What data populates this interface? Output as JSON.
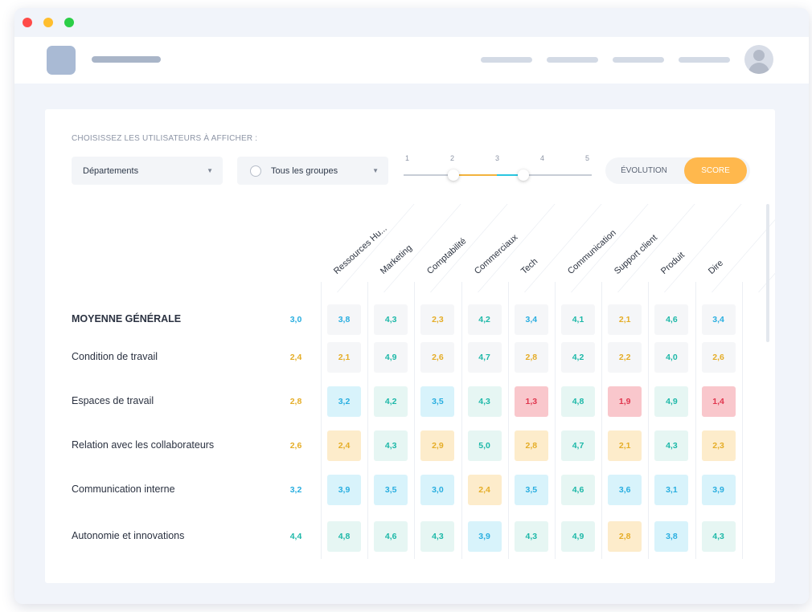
{
  "filters": {
    "title": "CHOISISSEZ LES UTILISATEURS À AFFICHER :",
    "dept_select": "Départements",
    "group_select": "Tous les groupes",
    "slider_labels": [
      "1",
      "2",
      "3",
      "4",
      "5"
    ],
    "view_toggle": {
      "evolution": "ÉVOLUTION",
      "score": "SCORE"
    }
  },
  "colors": {
    "teal": "#1db8a8",
    "blue": "#29aee0",
    "yellow": "#e5ad27",
    "red": "#e0364e",
    "teal_bg": "#e6f6f3",
    "blue_bg": "#d8f3fb",
    "yellow_bg": "#fdeccb",
    "red_bg": "#f9c7cc",
    "neutral_bg": "#f5f6f8",
    "accent": "#ffb84d"
  },
  "table": {
    "columns": [
      "Ressources Hu...",
      "Marketing",
      "Comptabilité",
      "Commerciaux",
      "Tech",
      "Communication",
      "Support client",
      "Produit",
      "Dire"
    ],
    "rows": [
      {
        "label": "MOYENNE GÉNÉRALE",
        "main": true,
        "avg": "3,0",
        "avg_tone": "blue",
        "cells": [
          [
            "3,8",
            "blue",
            "neutral"
          ],
          [
            "4,3",
            "teal",
            "neutral"
          ],
          [
            "2,3",
            "yellow",
            "neutral"
          ],
          [
            "4,2",
            "teal",
            "neutral"
          ],
          [
            "3,4",
            "blue",
            "neutral"
          ],
          [
            "4,1",
            "teal",
            "neutral"
          ],
          [
            "2,1",
            "yellow",
            "neutral"
          ],
          [
            "4,6",
            "teal",
            "neutral"
          ],
          [
            "3,4",
            "blue",
            "neutral"
          ]
        ]
      },
      {
        "label": "Condition de travail",
        "avg": "2,4",
        "avg_tone": "yellow",
        "cells": [
          [
            "2,1",
            "yellow",
            "neutral"
          ],
          [
            "4,9",
            "teal",
            "neutral"
          ],
          [
            "2,6",
            "yellow",
            "neutral"
          ],
          [
            "4,7",
            "teal",
            "neutral"
          ],
          [
            "2,8",
            "yellow",
            "neutral"
          ],
          [
            "4,2",
            "teal",
            "neutral"
          ],
          [
            "2,2",
            "yellow",
            "neutral"
          ],
          [
            "4,0",
            "teal",
            "neutral"
          ],
          [
            "2,6",
            "yellow",
            "neutral"
          ]
        ]
      },
      {
        "label": "Espaces de travail",
        "avg": "2,8",
        "avg_tone": "yellow",
        "cells": [
          [
            "3,2",
            "blue",
            "blue"
          ],
          [
            "4,2",
            "teal",
            "teal"
          ],
          [
            "3,5",
            "blue",
            "blue"
          ],
          [
            "4,3",
            "teal",
            "teal"
          ],
          [
            "1,3",
            "red",
            "red"
          ],
          [
            "4,8",
            "teal",
            "teal"
          ],
          [
            "1,9",
            "red",
            "red"
          ],
          [
            "4,9",
            "teal",
            "teal"
          ],
          [
            "1,4",
            "red",
            "red"
          ]
        ]
      },
      {
        "label": "Relation avec les collaborateurs",
        "avg": "2,6",
        "avg_tone": "yellow",
        "cells": [
          [
            "2,4",
            "yellow",
            "yellow"
          ],
          [
            "4,3",
            "teal",
            "teal"
          ],
          [
            "2,9",
            "yellow",
            "yellow"
          ],
          [
            "5,0",
            "teal",
            "teal"
          ],
          [
            "2,8",
            "yellow",
            "yellow"
          ],
          [
            "4,7",
            "teal",
            "teal"
          ],
          [
            "2,1",
            "yellow",
            "yellow"
          ],
          [
            "4,3",
            "teal",
            "teal"
          ],
          [
            "2,3",
            "yellow",
            "yellow"
          ]
        ]
      },
      {
        "label": "Communication interne",
        "avg": "3,2",
        "avg_tone": "blue",
        "cells": [
          [
            "3,9",
            "blue",
            "blue"
          ],
          [
            "3,5",
            "blue",
            "blue"
          ],
          [
            "3,0",
            "blue",
            "blue"
          ],
          [
            "2,4",
            "yellow",
            "yellow"
          ],
          [
            "3,5",
            "blue",
            "blue"
          ],
          [
            "4,6",
            "teal",
            "teal"
          ],
          [
            "3,6",
            "blue",
            "blue"
          ],
          [
            "3,1",
            "blue",
            "blue"
          ],
          [
            "3,9",
            "blue",
            "blue"
          ]
        ]
      },
      {
        "label": "Autonomie et innovations",
        "avg": "4,4",
        "avg_tone": "teal",
        "cells": [
          [
            "4,8",
            "teal",
            "teal"
          ],
          [
            "4,6",
            "teal",
            "teal"
          ],
          [
            "4,3",
            "teal",
            "teal"
          ],
          [
            "3,9",
            "blue",
            "blue"
          ],
          [
            "4,3",
            "teal",
            "teal"
          ],
          [
            "4,9",
            "teal",
            "teal"
          ],
          [
            "2,8",
            "yellow",
            "yellow"
          ],
          [
            "3,8",
            "blue",
            "blue"
          ],
          [
            "4,3",
            "teal",
            "teal"
          ]
        ]
      }
    ]
  }
}
